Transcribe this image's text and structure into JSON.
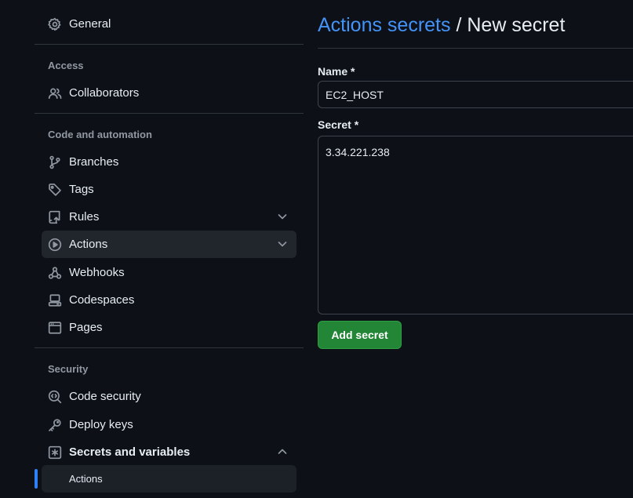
{
  "sidebar": {
    "general": "General",
    "access_heading": "Access",
    "collaborators": "Collaborators",
    "code_heading": "Code and automation",
    "branches": "Branches",
    "tags": "Tags",
    "rules": "Rules",
    "actions": "Actions",
    "webhooks": "Webhooks",
    "codespaces": "Codespaces",
    "pages": "Pages",
    "security_heading": "Security",
    "code_security": "Code security",
    "deploy_keys": "Deploy keys",
    "secrets_variables": "Secrets and variables",
    "secrets_sub_actions": "Actions"
  },
  "page": {
    "breadcrumb_link": "Actions secrets",
    "separator": " / ",
    "title": "New secret"
  },
  "form": {
    "name_label": "Name *",
    "name_value": "EC2_HOST",
    "secret_label": "Secret *",
    "secret_value": "3.34.221.238",
    "submit_label": "Add secret"
  },
  "colors": {
    "background": "#0d1117",
    "link": "#4493f8",
    "primary_button": "#238636",
    "active_indicator": "#2f81f7"
  },
  "icons": {
    "general": "gear-icon",
    "collaborators": "people-icon",
    "branches": "git-branch-icon",
    "tags": "tag-icon",
    "rules": "repo-push-icon",
    "actions": "play-icon",
    "webhooks": "webhook-icon",
    "codespaces": "codespaces-icon",
    "pages": "browser-icon",
    "code_security": "codescan-icon",
    "deploy_keys": "key-icon",
    "secrets": "asterisk-icon"
  }
}
